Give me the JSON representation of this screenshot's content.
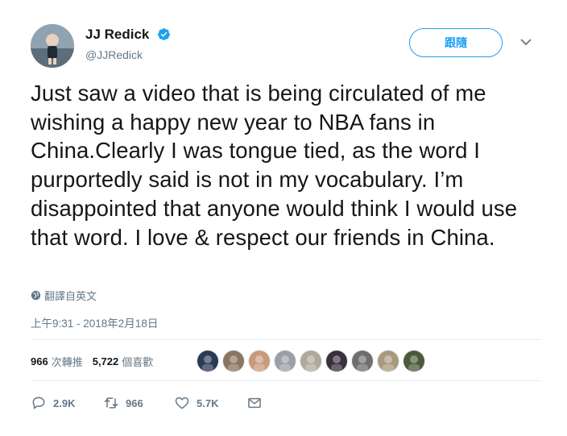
{
  "user": {
    "name": "JJ Redick",
    "handle": "@JJRedick",
    "follow_label": "跟隨"
  },
  "tweet": {
    "text": "Just saw a video that is being circulated of me wishing a happy new year to NBA fans in China.Clearly I was tongue tied, as the word I purportedly said is not in my vocabulary. I’m disappointed that anyone would think I would use that word. I love & respect our friends in China.",
    "translate_label": "翻譯自英文",
    "timestamp": "上午9:31 - 2018年2月18日"
  },
  "stats": {
    "retweets_count": "966",
    "retweets_label": "次轉推",
    "likes_count": "5,722",
    "likes_label": "個喜歡"
  },
  "likers_avatar_colors": [
    "#2b3a55",
    "#8a7560",
    "#c99a7a",
    "#9aa0a6",
    "#b0a89a",
    "#3a2f3c",
    "#6e6e6e",
    "#a99a7d",
    "#4a5a3a"
  ],
  "actions": {
    "reply_count": "2.9K",
    "retweet_count": "966",
    "like_count": "5.7K"
  },
  "colors": {
    "accent": "#1da1f2",
    "secondary_text": "#657786",
    "primary_text": "#14171a"
  },
  "icons": [
    "verified-badge-icon",
    "chevron-down-icon",
    "globe-icon",
    "reply-icon",
    "retweet-icon",
    "heart-icon",
    "message-icon"
  ]
}
